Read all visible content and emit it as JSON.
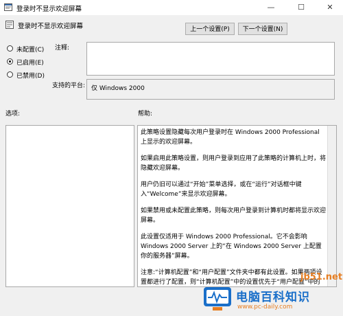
{
  "window": {
    "title": "登录时不显示欢迎屏幕"
  },
  "header": {
    "title": "登录时不显示欢迎屏幕"
  },
  "nav": {
    "prev_label": "上一个设置(P)",
    "next_label": "下一个设置(N)"
  },
  "options": [
    {
      "label": "未配置(C)",
      "selected": false
    },
    {
      "label": "已启用(E)",
      "selected": true
    },
    {
      "label": "已禁用(D)",
      "selected": false
    }
  ],
  "comment": {
    "label": "注释:",
    "value": ""
  },
  "platform": {
    "label": "支持的平台:",
    "value": "仅 Windows 2000"
  },
  "options_section": {
    "label": "选项:"
  },
  "help_section": {
    "label": "帮助:",
    "paragraphs": [
      "此策略设置隐藏每次用户登录时在 Windows 2000 Professional 上显示的欢迎屏幕。",
      "如果启用此策略设置，则用户登录到应用了此策略的计算机上时，将隐藏欢迎屏幕。",
      "用户仍旧可以通过“开始”菜单选择，或在“运行”对话框中键入“Welcome”来显示欢迎屏幕。",
      "如果禁用或未配置此策略，则每次用户登录到计算机时都将显示欢迎屏幕。",
      "此设置仅适用于 Windows 2000 Professional。它不会影响 Windows 2000 Server 上的“在 Windows 2000 Server 上配置你的服务器”屏幕。",
      "注意:“计算机配置”和“用户配置”文件夹中都有此设置。如果两项设置都进行了配置，则“计算机配置”中的设置优先于“用户配置”中的设置。"
    ]
  },
  "watermark": {
    "site_text": "jb51.net",
    "brand_name": "电脑百科知识",
    "brand_url": "www.pc-daily.com"
  },
  "colors": {
    "accent": "#1b7fd1",
    "brand_blue": "#1a6fc9",
    "watermark_orange": "#e67e22"
  }
}
